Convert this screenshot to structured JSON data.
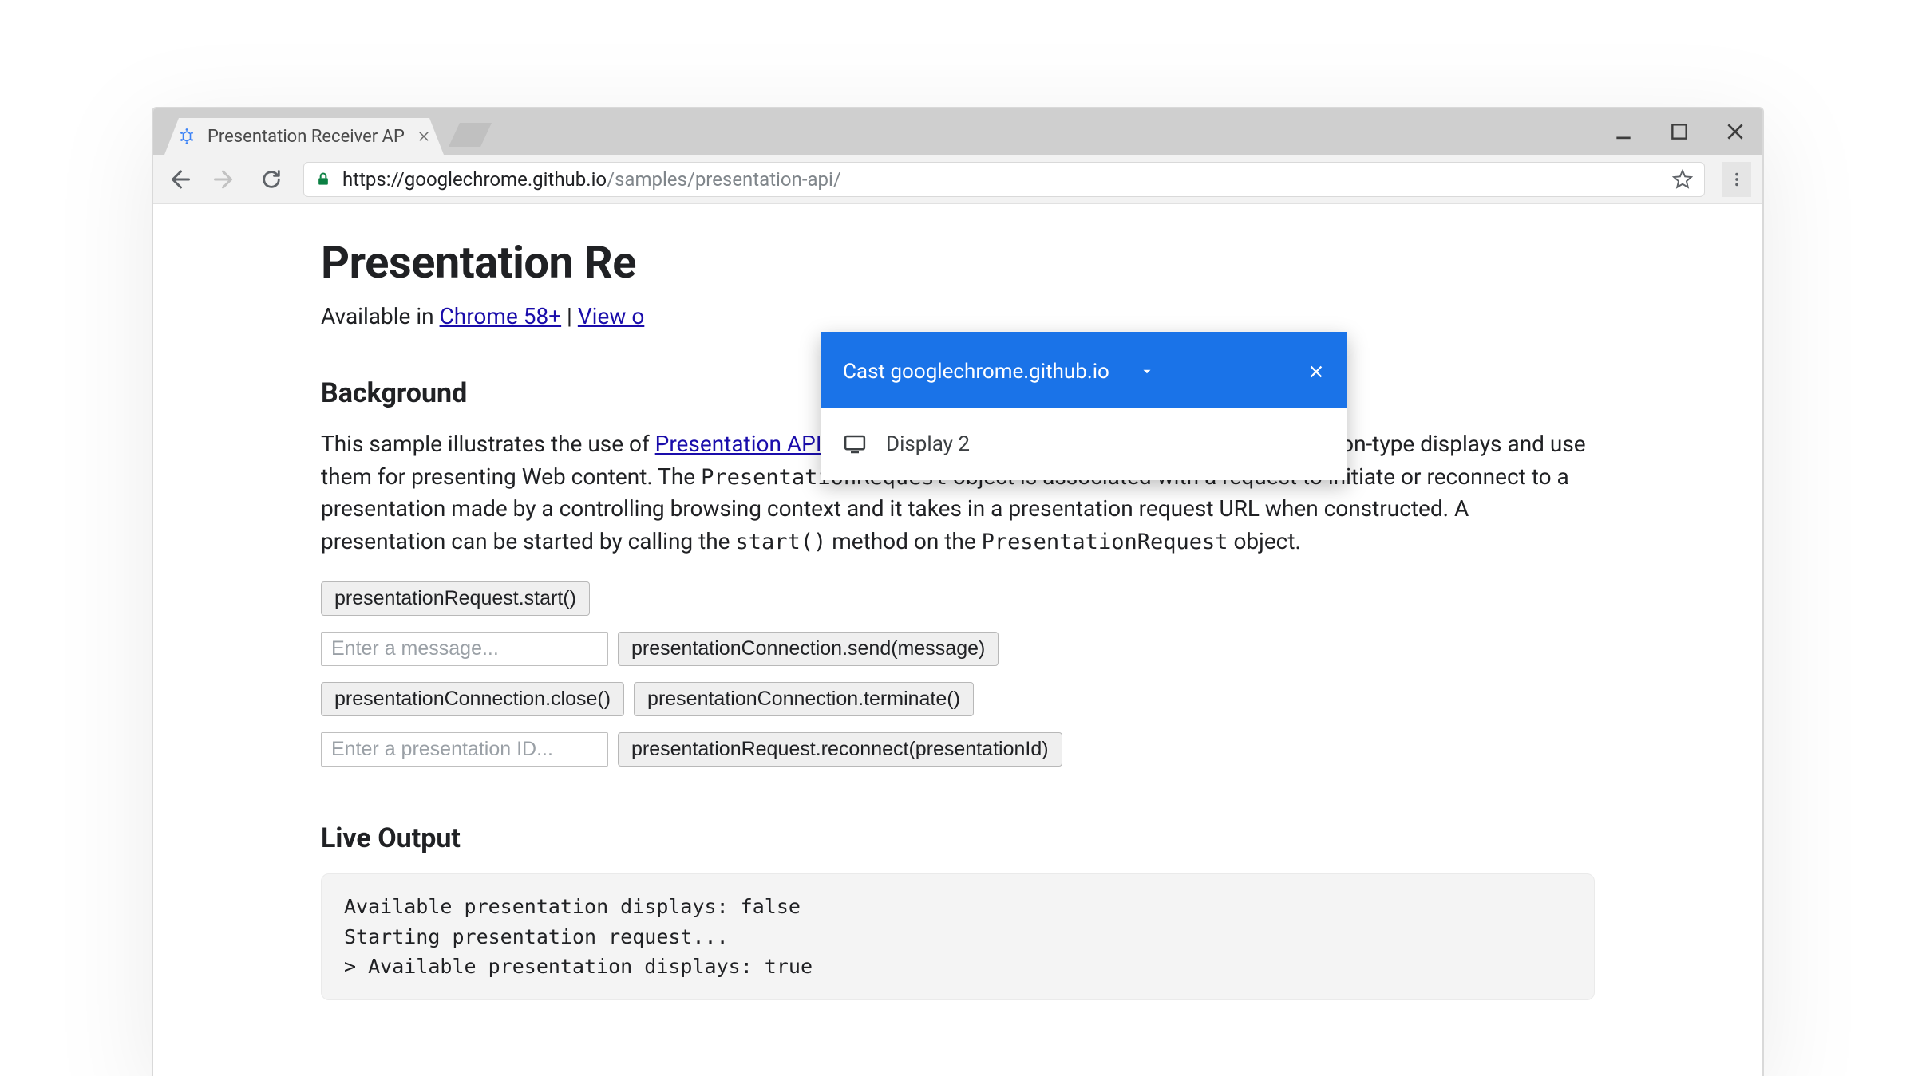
{
  "window": {
    "tab_title": "Presentation Receiver AP",
    "minimize_aria": "Minimize",
    "maximize_aria": "Maximize",
    "close_aria": "Close"
  },
  "toolbar": {
    "back_aria": "Back",
    "forward_aria": "Forward",
    "reload_aria": "Reload",
    "secure_aria": "Secure",
    "url_https": "https",
    "url_origin": "://googlechrome.github.io",
    "url_path": "/samples/presentation-api/",
    "star_aria": "Bookmark",
    "menu_aria": "Chrome menu"
  },
  "page": {
    "title": "Presentation Re",
    "available_prefix": "Available in ",
    "chrome_link": "Chrome 58+",
    "pipe": " | ",
    "view_on": "View o",
    "background_heading": "Background",
    "bg_p_lead": "This sample illustrates the use of ",
    "bg_p_link": "Presentation API",
    "bg_p_after_link": ", which gives the ability to access external presentation-type displays and use them for presenting Web content. The ",
    "bg_code_1": "PresentationRequest",
    "bg_p_mid": " object is associated with a request to initiate or reconnect to a presentation made by a controlling browsing context and it takes in a presentation request URL when constructed. A presentation can be started by calling the ",
    "bg_code_2": "start()",
    "bg_p_tail": " method on the ",
    "bg_code_3": "PresentationRequest",
    "bg_p_end": " object.",
    "btn_start": "presentationRequest.start()",
    "msg_placeholder": "Enter a message...",
    "btn_send": "presentationConnection.send(message)",
    "btn_close": "presentationConnection.close()",
    "btn_terminate": "presentationConnection.terminate()",
    "id_placeholder": "Enter a presentation ID...",
    "btn_reconnect": "presentationRequest.reconnect(presentationId)",
    "live_output_heading": "Live Output",
    "live_output_text": "Available presentation displays: false\nStarting presentation request...\n> Available presentation displays: true"
  },
  "cast": {
    "title": "Cast googlechrome.github.io",
    "close_aria": "Close cast dialog",
    "device_name": "Display 2"
  }
}
